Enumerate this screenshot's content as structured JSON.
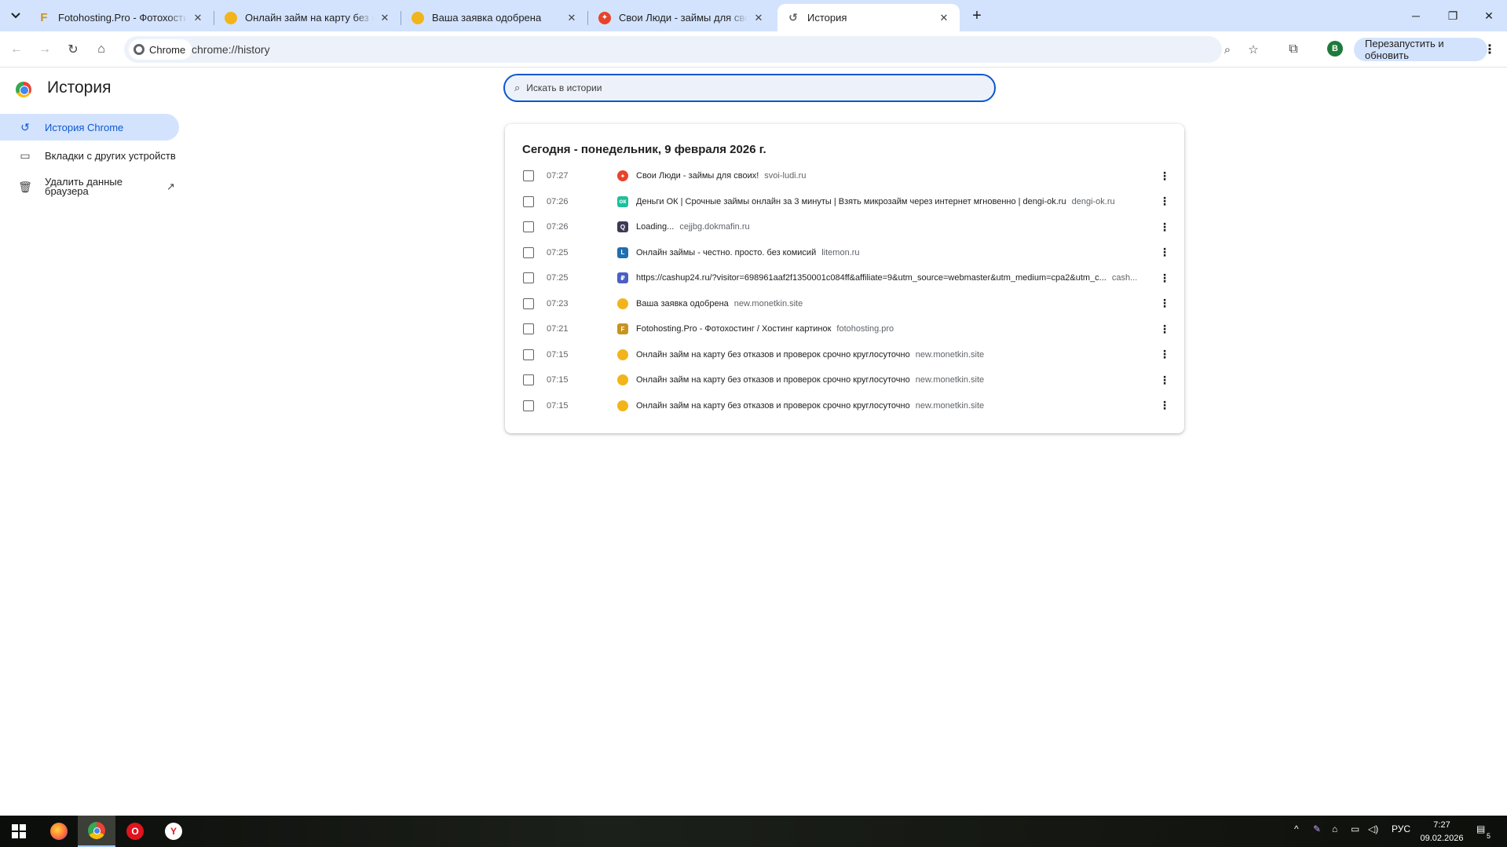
{
  "tabs": [
    {
      "title": "Fotohosting.Pro - Фотохостинг / Хостинг картинок",
      "active": false,
      "favicon_color": "#c8941f",
      "favicon_glyph": "F",
      "favicon": "fotohosting-favicon"
    },
    {
      "title": "Онлайн займ на карту без отказов",
      "active": false,
      "favicon_color": "#f2b41b",
      "favicon_glyph": "",
      "favicon": "coin-favicon"
    },
    {
      "title": "Ваша заявка одобрена",
      "active": false,
      "favicon_color": "#f2b41b",
      "favicon_glyph": "",
      "favicon": "coin-favicon"
    },
    {
      "title": "Свои Люди - займы для своих",
      "active": false,
      "favicon_color": "#e8432a",
      "favicon_glyph": "✦",
      "favicon": "svoi-ludi-favicon"
    },
    {
      "title": "История",
      "active": true,
      "favicon_color": "#5f6368",
      "favicon_glyph": "↺",
      "favicon": "history-favicon"
    }
  ],
  "toolbar": {
    "chip_label": "Chrome",
    "url": "chrome://history",
    "profile_initial": "В",
    "relaunch_label": "Перезапустить и обновить"
  },
  "sidebar": {
    "heading": "История",
    "items": [
      {
        "label": "История Chrome",
        "icon": "history-icon"
      },
      {
        "label": "Вкладки с других устройств",
        "icon": "devices-icon"
      },
      {
        "label": "Удалить данные браузера",
        "icon": "trash-icon"
      }
    ]
  },
  "search": {
    "placeholder": "Искать в истории"
  },
  "history": {
    "date_heading": "Сегодня - понедельник, 9 февраля 2026 г.",
    "entries": [
      {
        "time": "07:27",
        "title": "Свои Люди - займы для своих!",
        "domain": "svoi-ludi.ru",
        "favicon_color": "#e8432a",
        "favicon_glyph": "✦",
        "favicon_shape": "round"
      },
      {
        "time": "07:26",
        "title": "Деньги ОК | Срочные займы онлайн за 3 минуты | Взять микрозайм через интернет мгновенно | dengi-ok.ru",
        "domain": "dengi-ok.ru",
        "favicon_color": "#1fbf9b",
        "favicon_glyph": "ок",
        "favicon_shape": "square"
      },
      {
        "time": "07:26",
        "title": "Loading...",
        "domain": "cejjbg.dokmafin.ru",
        "favicon_color": "#3d3a55",
        "favicon_glyph": "Q",
        "favicon_shape": "square"
      },
      {
        "time": "07:25",
        "title": "Онлайн займы - честно. просто. без комисий",
        "domain": "litemon.ru",
        "favicon_color": "#1e6fb0",
        "favicon_glyph": "L",
        "favicon_shape": "square"
      },
      {
        "time": "07:25",
        "title": "https://cashup24.ru/?visitor=698961aaf2f1350001c084ff&affiliate=9&utm_source=webmaster&utm_medium=cpa2&utm_c...",
        "domain": "cash...",
        "favicon_color": "#4b5fc4",
        "favicon_glyph": "₽",
        "favicon_shape": "square"
      },
      {
        "time": "07:23",
        "title": "Ваша заявка одобрена",
        "domain": "new.monetkin.site",
        "favicon_color": "#f2b41b",
        "favicon_glyph": "",
        "favicon_shape": "round"
      },
      {
        "time": "07:21",
        "title": "Fotohosting.Pro - Фотохостинг / Хостинг картинок",
        "domain": "fotohosting.pro",
        "favicon_color": "#c8941f",
        "favicon_glyph": "F",
        "favicon_shape": "square"
      },
      {
        "time": "07:15",
        "title": "Онлайн займ на карту без отказов и проверок срочно круглосуточно",
        "domain": "new.monetkin.site",
        "favicon_color": "#f2b41b",
        "favicon_glyph": "",
        "favicon_shape": "round"
      },
      {
        "time": "07:15",
        "title": "Онлайн займ на карту без отказов и проверок срочно круглосуточно",
        "domain": "new.monetkin.site",
        "favicon_color": "#f2b41b",
        "favicon_glyph": "",
        "favicon_shape": "round"
      },
      {
        "time": "07:15",
        "title": "Онлайн займ на карту без отказов и проверок срочно круглосуточно",
        "domain": "new.monetkin.site",
        "favicon_color": "#f2b41b",
        "favicon_glyph": "",
        "favicon_shape": "round"
      }
    ]
  },
  "taskbar": {
    "apps": [
      {
        "name": "firefox",
        "color": "#ff7139",
        "glyph": ""
      },
      {
        "name": "chrome",
        "color": "#4285f4",
        "glyph": ""
      },
      {
        "name": "opera",
        "color": "#e0141e",
        "glyph": "O"
      },
      {
        "name": "yandex",
        "color": "#ffffff",
        "glyph": "Y"
      }
    ],
    "language": "РУС",
    "time": "7:27",
    "date": "09.02.2026",
    "notifications": "5"
  },
  "colors": {
    "accent": "#0b57d0",
    "tabstrip": "#d3e3fd",
    "omnibox": "#edf2fa"
  }
}
